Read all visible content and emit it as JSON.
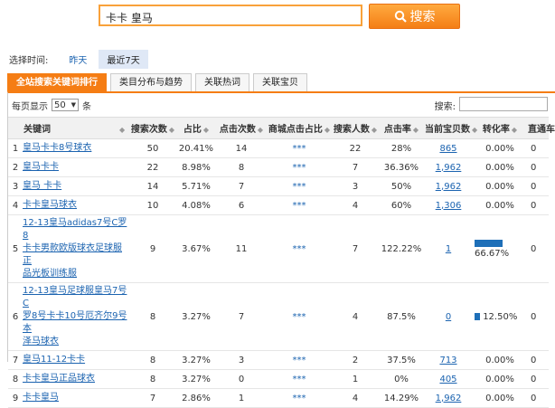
{
  "search": {
    "value": "卡卡 皇马",
    "button_label": "搜索"
  },
  "time": {
    "label": "选择时间:",
    "options": [
      "昨天",
      "最近7天"
    ],
    "active": 1
  },
  "tabs": [
    "全站搜索关键词排行",
    "类目分布与趋势",
    "关联热词",
    "关联宝贝"
  ],
  "pager": {
    "prefix": "每页显示",
    "size": "50",
    "suffix": "条",
    "filter_label": "搜索:"
  },
  "columns": [
    "",
    "关键词",
    "搜索次数",
    "占比",
    "点击次数",
    "商城点击占比",
    "搜索人数",
    "点击率",
    "当前宝贝数",
    "转化率",
    "直通车"
  ],
  "colors": {
    "accent": "#f57d14",
    "link": "#1b63b0",
    "bar": "#1e6fb8"
  },
  "rows": [
    {
      "idx": "1",
      "kw": [
        "皇马卡卡8号球衣"
      ],
      "searches": "50",
      "share": "20.41%",
      "clicks": "14",
      "mall": "***",
      "users": "22",
      "ctr": "28%",
      "items": "865",
      "conv": "0.00%",
      "conv_bar": 0,
      "ztc": "0"
    },
    {
      "idx": "2",
      "kw": [
        "皇马卡卡"
      ],
      "searches": "22",
      "share": "8.98%",
      "clicks": "8",
      "mall": "***",
      "users": "7",
      "ctr": "36.36%",
      "items": "1,962",
      "conv": "0.00%",
      "conv_bar": 0,
      "ztc": "0"
    },
    {
      "idx": "3",
      "kw": [
        "皇马 卡卡"
      ],
      "searches": "14",
      "share": "5.71%",
      "clicks": "7",
      "mall": "***",
      "users": "3",
      "ctr": "50%",
      "items": "1,962",
      "conv": "0.00%",
      "conv_bar": 0,
      "ztc": "0"
    },
    {
      "idx": "4",
      "kw": [
        "卡卡皇马球衣"
      ],
      "searches": "10",
      "share": "4.08%",
      "clicks": "6",
      "mall": "***",
      "users": "4",
      "ctr": "60%",
      "items": "1,306",
      "conv": "0.00%",
      "conv_bar": 0,
      "ztc": "0"
    },
    {
      "idx": "5",
      "kw": [
        "12-13皇马adidas7号C罗8",
        "卡卡男款欧版球衣足球服正",
        "品光板训练服"
      ],
      "searches": "9",
      "share": "3.67%",
      "clicks": "11",
      "mall": "***",
      "users": "7",
      "ctr": "122.22%",
      "items": "1",
      "conv": "66.67%",
      "conv_bar": 0.6667,
      "ztc": "0"
    },
    {
      "idx": "6",
      "kw": [
        "12-13皇马足球服皇马7号C",
        "罗8号卡卡10号厄齐尔9号本",
        "泽马球衣"
      ],
      "searches": "8",
      "share": "3.27%",
      "clicks": "7",
      "mall": "***",
      "users": "4",
      "ctr": "87.5%",
      "items": "0",
      "conv": "12.50%",
      "conv_bar": 0.125,
      "ztc": "0"
    },
    {
      "idx": "7",
      "kw": [
        "皇马11-12卡卡"
      ],
      "searches": "8",
      "share": "3.27%",
      "clicks": "3",
      "mall": "***",
      "users": "2",
      "ctr": "37.5%",
      "items": "713",
      "conv": "0.00%",
      "conv_bar": 0,
      "ztc": "0"
    },
    {
      "idx": "8",
      "kw": [
        "卡卡皇马正品球衣"
      ],
      "searches": "8",
      "share": "3.27%",
      "clicks": "0",
      "mall": "***",
      "users": "1",
      "ctr": "0%",
      "items": "405",
      "conv": "0.00%",
      "conv_bar": 0,
      "ztc": "0"
    },
    {
      "idx": "9",
      "kw": [
        "卡卡皇马"
      ],
      "searches": "7",
      "share": "2.86%",
      "clicks": "1",
      "mall": "***",
      "users": "4",
      "ctr": "14.29%",
      "items": "1,962",
      "conv": "0.00%",
      "conv_bar": 0,
      "ztc": "0"
    }
  ]
}
